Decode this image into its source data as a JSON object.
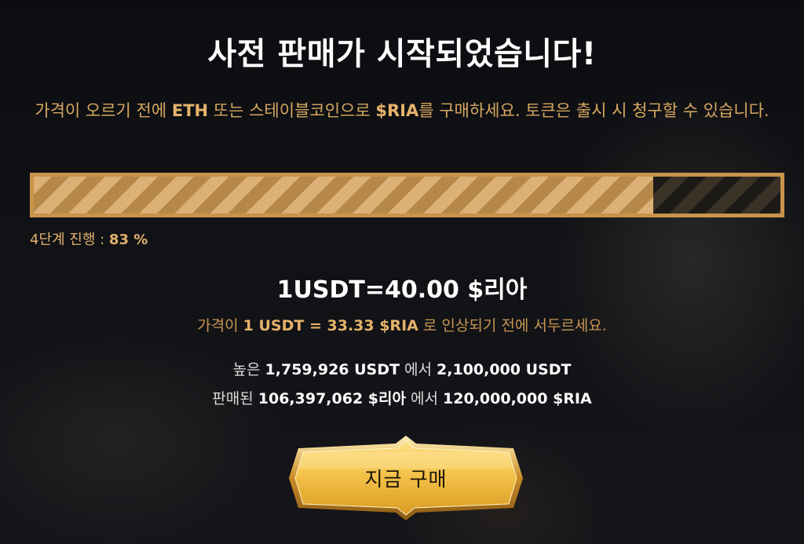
{
  "presale": {
    "title": "사전 판매가 시작되었습니다!",
    "subtitle": {
      "p1": "가격이 오르기 전에 ",
      "eth": "ETH",
      "p2": " 또는 스테이블코인으로 ",
      "ria": "$RIA",
      "p3": "를 구매하세요. 토큰은 출시 시 청구할 수 있습니다."
    }
  },
  "progress": {
    "percent": 83,
    "label_prefix": "4단계 진행 : ",
    "label_value": "83 %",
    "fill_color": "#dcb076",
    "stripe_color": "#b58848",
    "border_color": "#c9934c"
  },
  "rate": {
    "current": "1USDT=40.00 $리아",
    "note": {
      "p1": "가격이 ",
      "value": "1 USDT = 33.33 $RIA",
      "p2": " 로 인상되기 전에 서두르세요."
    }
  },
  "stats": {
    "raised": {
      "p1": "높은 ",
      "value": "1,759,926 USDT",
      "p2": " 에서 ",
      "target": "2,100,000 USDT"
    },
    "sold": {
      "p1": "판매된 ",
      "value": "106,397,062 $리아",
      "p2": " 에서 ",
      "target": "120,000,000 $RIA"
    }
  },
  "buy_button": {
    "label": "지금 구매",
    "gold": "#f4c95a"
  }
}
